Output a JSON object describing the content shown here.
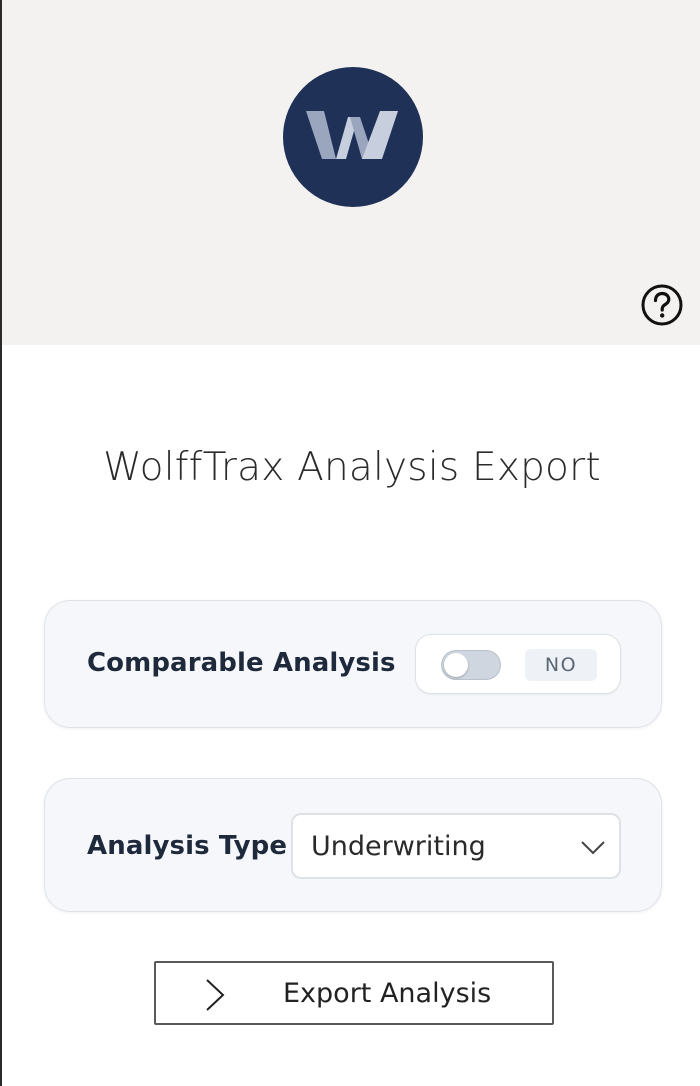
{
  "header": {
    "logo_letter": "W",
    "logo_icon": "wolfftrax-logo",
    "help_icon": "help-circle-icon",
    "background": "#f3f2f1",
    "logo_color": "#1f3157"
  },
  "main": {
    "title": "WolffTrax Analysis Export"
  },
  "comparable": {
    "label": "Comparable Analysis",
    "toggle_state": "NO",
    "toggle_on": false
  },
  "analysis_type": {
    "label": "Analysis Type",
    "selected": "Underwriting",
    "chevron_icon": "chevron-down-icon"
  },
  "actions": {
    "export_label": "Export Analysis",
    "export_icon": "chevron-right-icon"
  }
}
